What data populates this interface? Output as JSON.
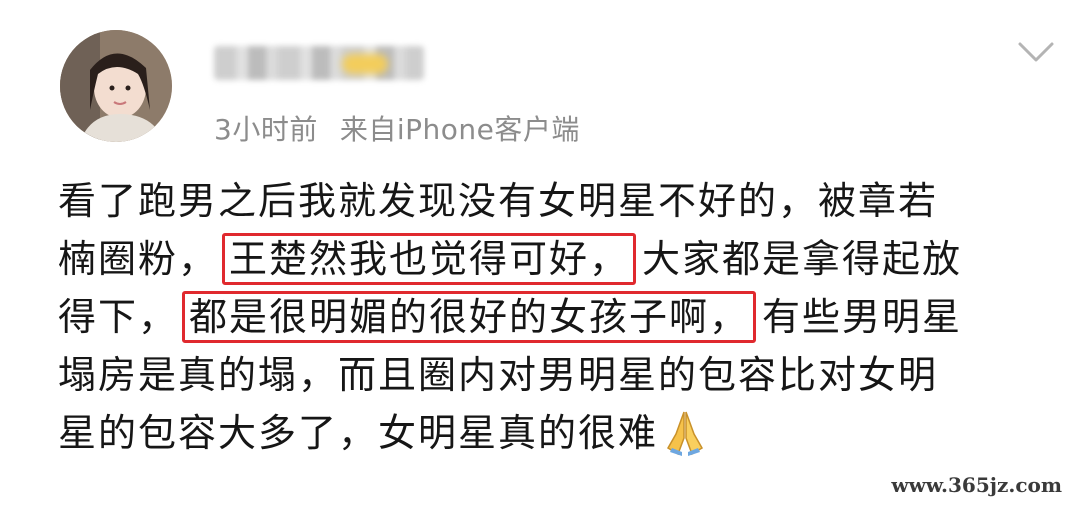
{
  "header": {
    "time": "3小时前",
    "source": "来自iPhone客户端"
  },
  "content": {
    "line1": "看了跑男之后我就发现没有女明星不好的，被章若",
    "line2_before": "楠圈粉，",
    "line2_highlight": "王楚然我也觉得可好，",
    "line2_after": "大家都是拿得起放",
    "line3_before": "得下，",
    "line3_highlight": "都是很明媚的很好的女孩子啊，",
    "line3_after": "有些男明星",
    "line4": "塌房是真的塌，而且圈内对男明星的包容比对女明",
    "line5": "星的包容大多了，女明星真的很难"
  },
  "watermark": "www.365jz.com",
  "icons": {
    "more": "chevron-down-icon",
    "emoji": "praying-hands-icon"
  },
  "colors": {
    "highlight_border": "#e0292e",
    "meta_text": "#8c8c8c"
  }
}
